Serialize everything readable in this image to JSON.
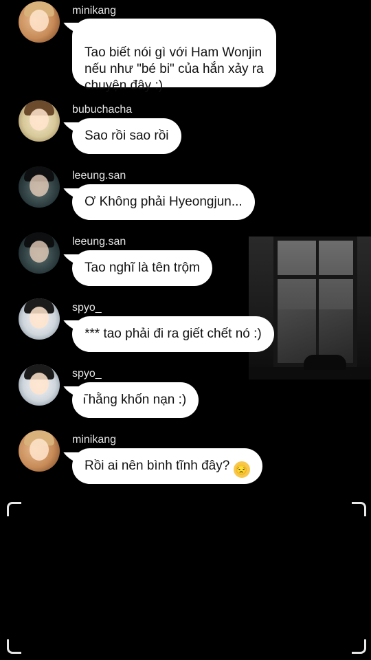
{
  "messages": [
    {
      "username": "minikang",
      "text": " Tao biết nói gì với Ham Wonjin\nnếu như \"bé bi\" của hắn xảy ra\nchuyện đây :)",
      "avatar_palette": "#c78b58"
    },
    {
      "username": "bubuchacha",
      "text": "Sao rồi sao rồi",
      "avatar_palette": "#d8c99a"
    },
    {
      "username": "leeung.san",
      "text": "Ơ Không phải Hyeongjun...",
      "avatar_palette": "#2a3a3c"
    },
    {
      "username": "leeung.san",
      "text": "Tao nghĩ là tên trộm",
      "avatar_palette": "#2a3a3c"
    },
    {
      "username": "spyo_",
      "text": "*** tao phải đi ra giết chết nó :)",
      "avatar_palette": "#cfd6dc"
    },
    {
      "username": "spyo_",
      "text": "Thằng khốn nạn :)",
      "avatar_palette": "#cfd6dc"
    },
    {
      "username": "minikang",
      "text": "Rồi ai nên bình tĩnh đây?",
      "emoji": "unamused-face-emoji",
      "avatar_palette": "#c78b58"
    }
  ],
  "emoji_glyph": "😒"
}
